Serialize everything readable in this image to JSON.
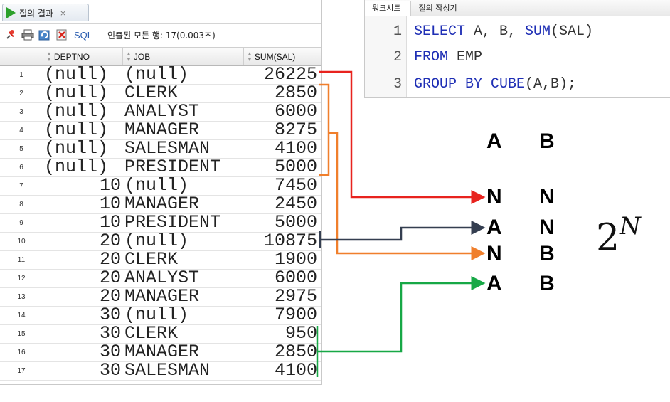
{
  "result_panel": {
    "tab_label": "질의 결과",
    "tab_close": "×",
    "toolbar": {
      "sql_label": "SQL",
      "status_text": "인출된 모든 행: 17(0.003초)"
    },
    "columns": [
      "DEPTNO",
      "JOB",
      "SUM(SAL)"
    ],
    "rows": [
      {
        "rownum": "1",
        "deptno": "(null)",
        "job": "(null)",
        "sum_sal": "26225"
      },
      {
        "rownum": "2",
        "deptno": "(null)",
        "job": "CLERK",
        "sum_sal": "2850"
      },
      {
        "rownum": "3",
        "deptno": "(null)",
        "job": "ANALYST",
        "sum_sal": "6000"
      },
      {
        "rownum": "4",
        "deptno": "(null)",
        "job": "MANAGER",
        "sum_sal": "8275"
      },
      {
        "rownum": "5",
        "deptno": "(null)",
        "job": "SALESMAN",
        "sum_sal": "4100"
      },
      {
        "rownum": "6",
        "deptno": "(null)",
        "job": "PRESIDENT",
        "sum_sal": "5000"
      },
      {
        "rownum": "7",
        "deptno": "10",
        "job": "(null)",
        "sum_sal": "7450"
      },
      {
        "rownum": "8",
        "deptno": "10",
        "job": "MANAGER",
        "sum_sal": "2450"
      },
      {
        "rownum": "9",
        "deptno": "10",
        "job": "PRESIDENT",
        "sum_sal": "5000"
      },
      {
        "rownum": "10",
        "deptno": "20",
        "job": "(null)",
        "sum_sal": "10875"
      },
      {
        "rownum": "11",
        "deptno": "20",
        "job": "CLERK",
        "sum_sal": "1900"
      },
      {
        "rownum": "12",
        "deptno": "20",
        "job": "ANALYST",
        "sum_sal": "6000"
      },
      {
        "rownum": "13",
        "deptno": "20",
        "job": "MANAGER",
        "sum_sal": "2975"
      },
      {
        "rownum": "14",
        "deptno": "30",
        "job": "(null)",
        "sum_sal": "7900"
      },
      {
        "rownum": "15",
        "deptno": "30",
        "job": "CLERK",
        "sum_sal": "950"
      },
      {
        "rownum": "16",
        "deptno": "30",
        "job": "MANAGER",
        "sum_sal": "2850"
      },
      {
        "rownum": "17",
        "deptno": "30",
        "job": "SALESMAN",
        "sum_sal": "4100"
      }
    ]
  },
  "worksheet": {
    "tabs": [
      "워크시트",
      "질의 작성기"
    ],
    "line_numbers": [
      "1",
      "2",
      "3"
    ],
    "code": {
      "line1_kw1": "SELECT",
      "line1_rest": " A, B, ",
      "line1_kw2": "SUM",
      "line1_tail": "(SAL)",
      "line2_kw1": "FROM",
      "line2_rest": " EMP",
      "line3_kw1": "GROUP BY CUBE",
      "line3_rest": "(A,B);"
    }
  },
  "annotation": {
    "header": [
      "A",
      "B"
    ],
    "combos": [
      [
        "N",
        "N"
      ],
      [
        "A",
        "N"
      ],
      [
        "N",
        "B"
      ],
      [
        "A",
        "B"
      ]
    ],
    "formula_base": "2",
    "formula_exp": "N",
    "colors": {
      "red": "#e8231e",
      "orange": "#f07f2c",
      "navy": "#343e50",
      "green": "#17a846"
    }
  }
}
